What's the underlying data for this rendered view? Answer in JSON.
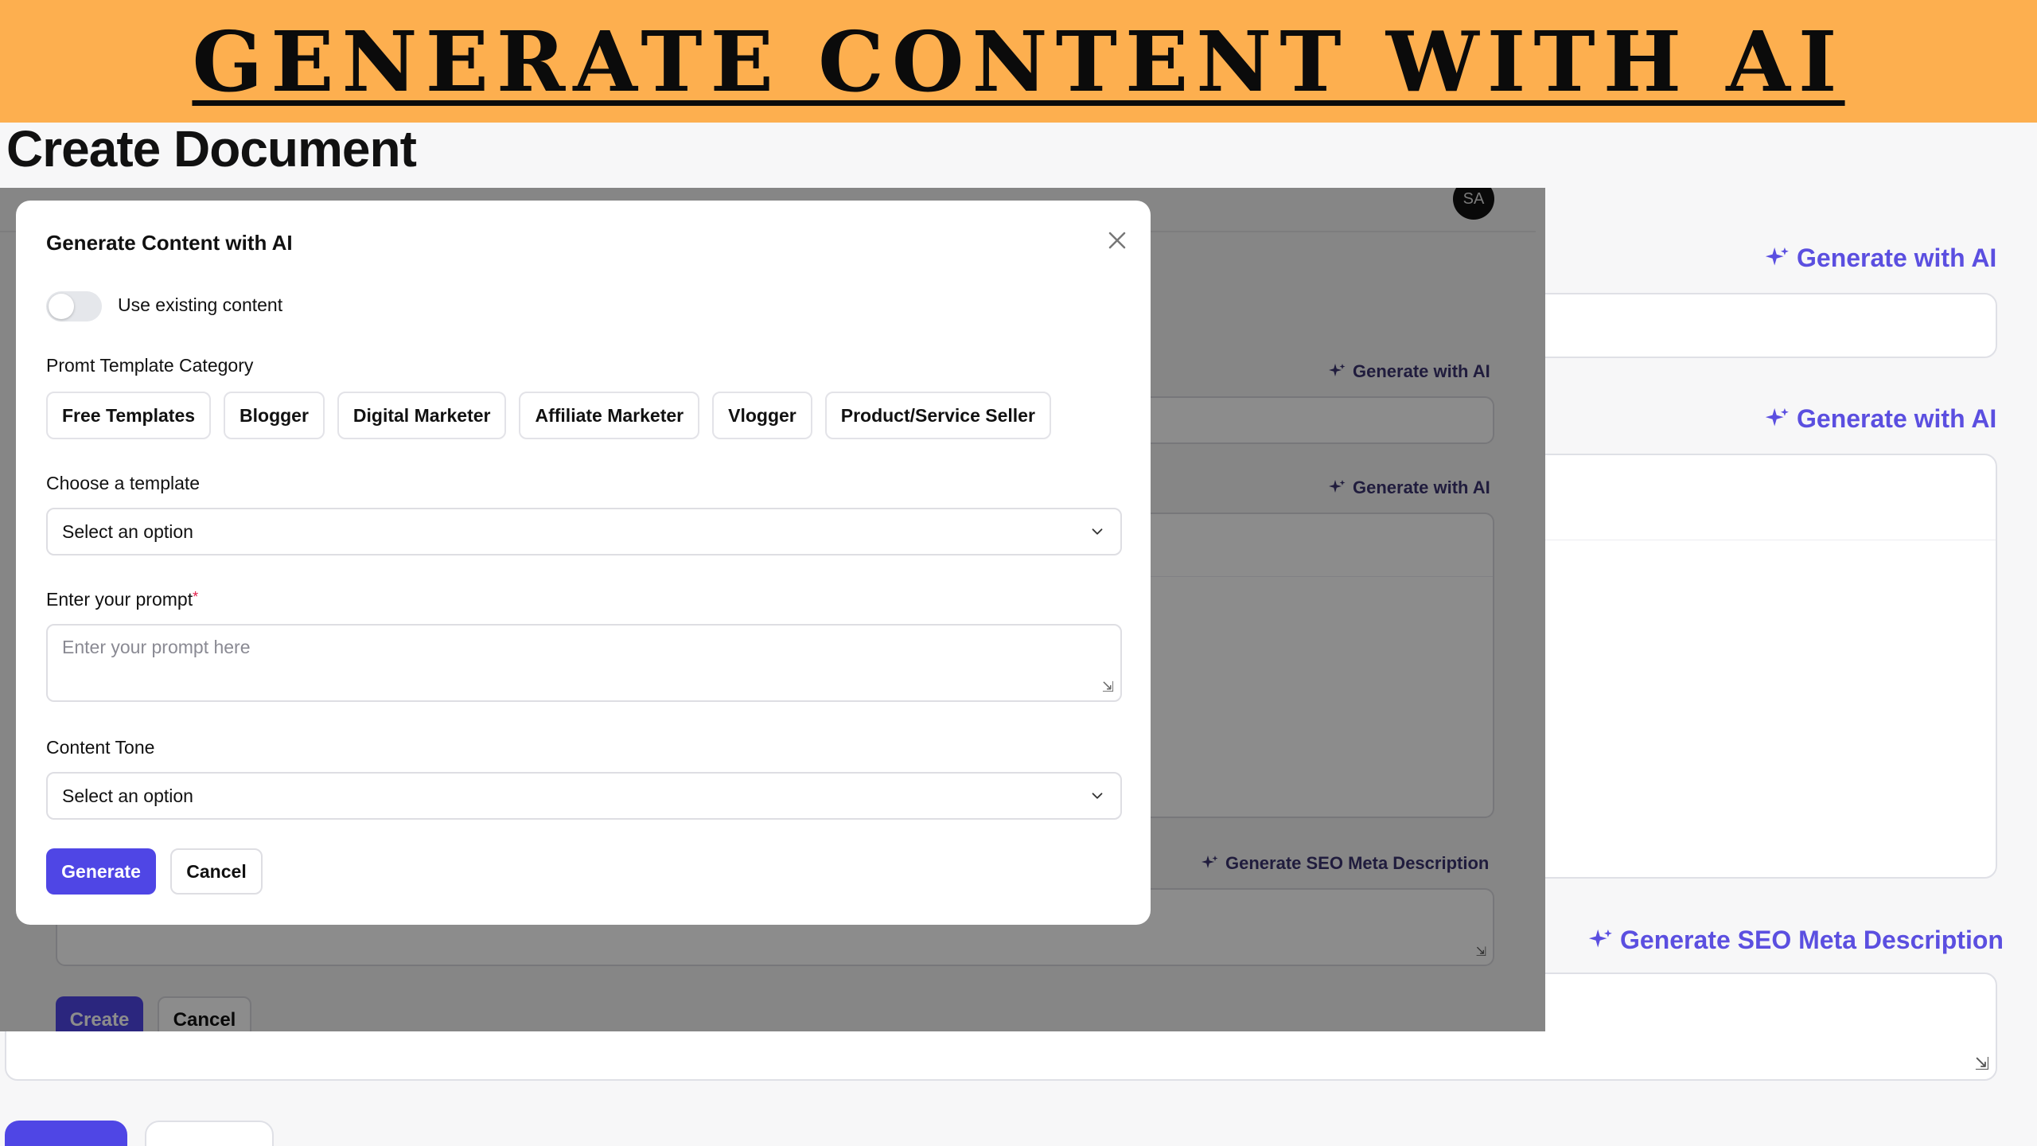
{
  "banner": {
    "title": "GENERATE CONTENT WITH AI"
  },
  "page": {
    "title": "Create Document",
    "generate_with_ai_label": "Generate with AI",
    "generate_seo_label": "Generate SEO Meta Description"
  },
  "middle": {
    "avatar_initials": "SA",
    "generate_with_ai_label": "Generate with AI",
    "generate_seo_label": "Generate SEO Meta Description",
    "create_label": "Create",
    "cancel_label": "Cancel"
  },
  "modal": {
    "title": "Generate Content with AI",
    "use_existing_label": "Use existing content",
    "use_existing_on": false,
    "category_label": "Promt Template Category",
    "categories": [
      "Free Templates",
      "Blogger",
      "Digital Marketer",
      "Affiliate Marketer",
      "Vlogger",
      "Product/Service Seller"
    ],
    "template_label": "Choose a template",
    "template_value": "Select an option",
    "prompt_label": "Enter your prompt",
    "prompt_required": "*",
    "prompt_placeholder": "Enter your prompt here",
    "tone_label": "Content Tone",
    "tone_value": "Select an option",
    "generate_label": "Generate",
    "cancel_label": "Cancel"
  },
  "colors": {
    "banner": "#fdaf4f",
    "accent": "#4f46e5",
    "link": "#5b4fe0"
  },
  "icons": [
    "sparkle-icon",
    "close-icon",
    "chevron-down-icon",
    "resize-handle-icon"
  ]
}
